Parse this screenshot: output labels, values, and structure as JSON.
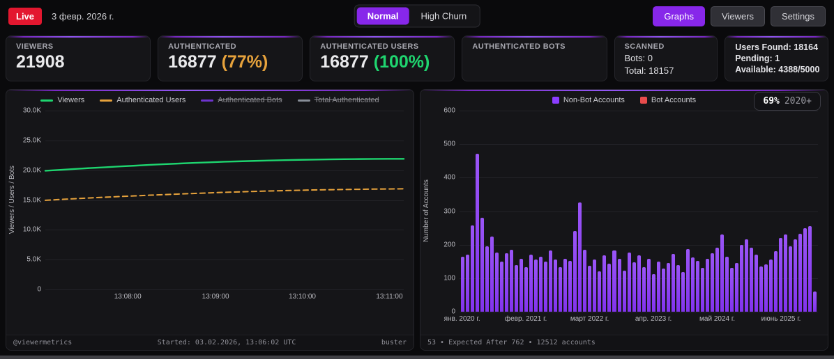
{
  "topbar": {
    "live_label": "Live",
    "date": "3 февр. 2026 г.",
    "mode_toggle": {
      "options": [
        "Normal",
        "High Churn"
      ],
      "selected": "Normal"
    },
    "nav": {
      "graphs": "Graphs",
      "viewers": "Viewers",
      "settings": "Settings",
      "active": "Graphs"
    }
  },
  "cards": {
    "viewers": {
      "label": "VIEWERS",
      "value": "21908"
    },
    "authenticated": {
      "label": "AUTHENTICATED",
      "value": "16877",
      "percent": "(77%)"
    },
    "authenticated_users": {
      "label": "AUTHENTICATED USERS",
      "value": "16877",
      "percent": "(100%)"
    },
    "authenticated_bots": {
      "label": "AUTHENTICATED BOTS",
      "value": ""
    },
    "scanned": {
      "label": "SCANNED",
      "bots": "Bots: 0",
      "total": "Total: 18157"
    },
    "quota": {
      "users_found": "Users Found: 18164",
      "pending": "Pending: 1",
      "available": "Available: 4388/5000"
    }
  },
  "colors": {
    "accent_purple": "#8a2be2",
    "live_red": "#e3172f",
    "percent_orange": "#e6a23c",
    "percent_green": "#1fd56f",
    "bar_purple": "#8b3dff",
    "bot_red": "#e74c4c"
  },
  "chart_data": [
    {
      "type": "line",
      "title": "",
      "ylabel": "Viewers / Users / Bots",
      "ylim": [
        0,
        30000
      ],
      "yticks": [
        "0",
        "5.0K",
        "10.0K",
        "15.0K",
        "20.0K",
        "25.0K",
        "30.0K"
      ],
      "xticks": [
        "13:08:00",
        "13:09:00",
        "13:10:00",
        "13:11:00"
      ],
      "xtick_positions": [
        0.23,
        0.475,
        0.717,
        0.96
      ],
      "grid": true,
      "legend_position": "top-center",
      "series": [
        {
          "name": "Viewers",
          "color": "#1ed56f",
          "style": "solid",
          "visible": true,
          "values": [
            19900,
            20060,
            20210,
            20360,
            20500,
            20640,
            20770,
            20900,
            21020,
            21130,
            21230,
            21330,
            21420,
            21500,
            21570,
            21630,
            21690,
            21740,
            21780,
            21820,
            21850,
            21870,
            21890,
            21900,
            21908
          ]
        },
        {
          "name": "Authenticated Users",
          "color": "#e6a23c",
          "style": "dashed",
          "visible": true,
          "values": [
            14950,
            15090,
            15220,
            15350,
            15470,
            15590,
            15700,
            15810,
            15910,
            16010,
            16110,
            16200,
            16290,
            16370,
            16450,
            16520,
            16580,
            16640,
            16690,
            16730,
            16770,
            16800,
            16830,
            16855,
            16877
          ]
        },
        {
          "name": "Authenticated Bots",
          "color": "#7c3aed",
          "style": "solid",
          "visible": false,
          "values": []
        },
        {
          "name": "Total Authenticated",
          "color": "#9ca3af",
          "style": "solid",
          "visible": false,
          "values": []
        }
      ],
      "footer": {
        "left": "@viewermetrics",
        "center": "Started: 03.02.2026, 13:06:02 UTC",
        "right": "buster"
      }
    },
    {
      "type": "bar",
      "title": "",
      "ylabel": "Number of Accounts",
      "ylim": [
        0,
        600
      ],
      "yticks": [
        "0",
        "100",
        "200",
        "300",
        "400",
        "500",
        "600"
      ],
      "xticks": [
        "янв. 2020 г.",
        "февр. 2021 г.",
        "март 2022 г.",
        "апр. 2023 г.",
        "май 2024 г.",
        "июнь 2025 г."
      ],
      "xtick_positions": [
        0.007,
        0.185,
        0.363,
        0.541,
        0.719,
        0.897
      ],
      "grid": true,
      "legend_position": "top-center",
      "legend": [
        {
          "name": "Non-Bot Accounts",
          "color": "#8b3dff"
        },
        {
          "name": "Bot Accounts",
          "color": "#e74c4c"
        }
      ],
      "badge": {
        "percent": "69%",
        "suffix": "2020+"
      },
      "categories_note": "monthly bars, Jan 2020 through Feb 2026",
      "values": [
        164,
        170,
        258,
        472,
        281,
        195,
        225,
        176,
        149,
        174,
        185,
        140,
        157,
        132,
        170,
        155,
        164,
        149,
        182,
        155,
        132,
        157,
        151,
        241,
        325,
        185,
        137,
        155,
        120,
        168,
        143,
        182,
        158,
        122,
        176,
        148,
        168,
        132,
        158,
        112,
        150,
        128,
        146,
        172,
        140,
        118,
        186,
        162,
        152,
        130,
        158,
        175,
        192,
        230,
        165,
        130,
        146,
        200,
        215,
        190,
        170,
        135,
        142,
        155,
        180,
        220,
        230,
        195,
        215,
        232,
        250,
        255,
        60
      ],
      "bot_values_all_zero": true,
      "footer": "53 • Expected After 762 • 12512 accounts"
    }
  ]
}
